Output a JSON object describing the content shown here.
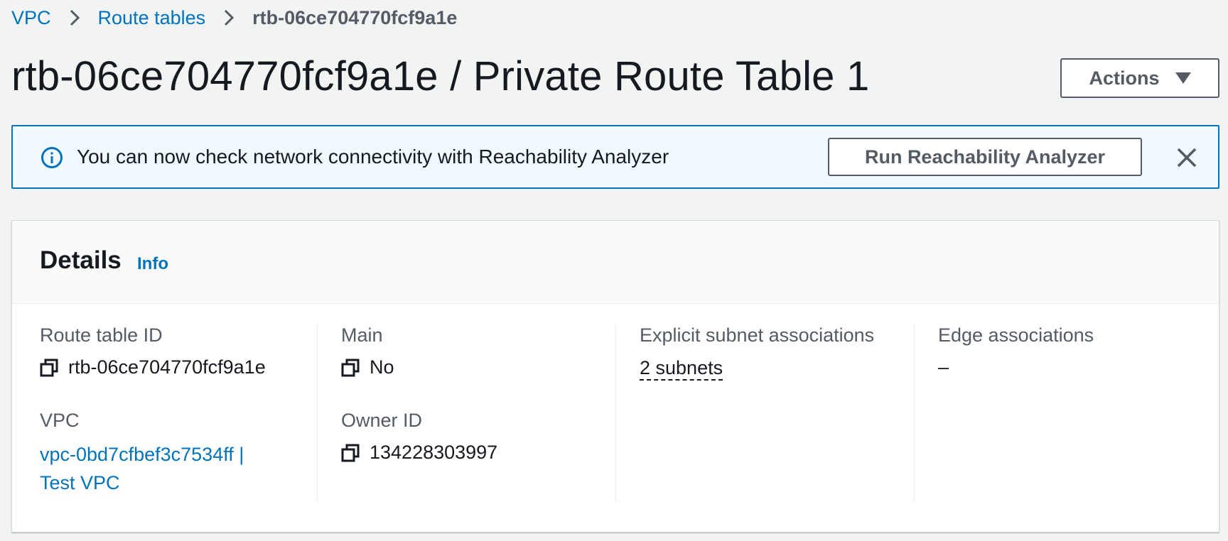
{
  "breadcrumb": {
    "items": [
      {
        "label": "VPC"
      },
      {
        "label": "Route tables"
      }
    ],
    "current": "rtb-06ce704770fcf9a1e"
  },
  "page": {
    "title": "rtb-06ce704770fcf9a1e / Private Route Table 1",
    "actions_label": "Actions"
  },
  "banner": {
    "message": "You can now check network connectivity with Reachability Analyzer",
    "button_label": "Run Reachability Analyzer"
  },
  "details": {
    "title": "Details",
    "info_label": "Info",
    "route_table_id": {
      "label": "Route table ID",
      "value": "rtb-06ce704770fcf9a1e"
    },
    "vpc": {
      "label": "VPC",
      "value_line1": "vpc-0bd7cfbef3c7534ff |",
      "value_line2": "Test VPC"
    },
    "main": {
      "label": "Main",
      "value": "No"
    },
    "owner_id": {
      "label": "Owner ID",
      "value": "134228303997"
    },
    "explicit_subnet_associations": {
      "label": "Explicit subnet associations",
      "value": "2 subnets"
    },
    "edge_associations": {
      "label": "Edge associations",
      "value": "–"
    }
  },
  "colors": {
    "link": "#0073bb",
    "banner_bg": "#f1faff",
    "banner_border": "#0073bb",
    "page_bg": "#f2f3f3"
  },
  "icons": [
    "chevron-right-icon",
    "info-icon",
    "close-icon",
    "copy-icon",
    "caret-down-icon"
  ]
}
